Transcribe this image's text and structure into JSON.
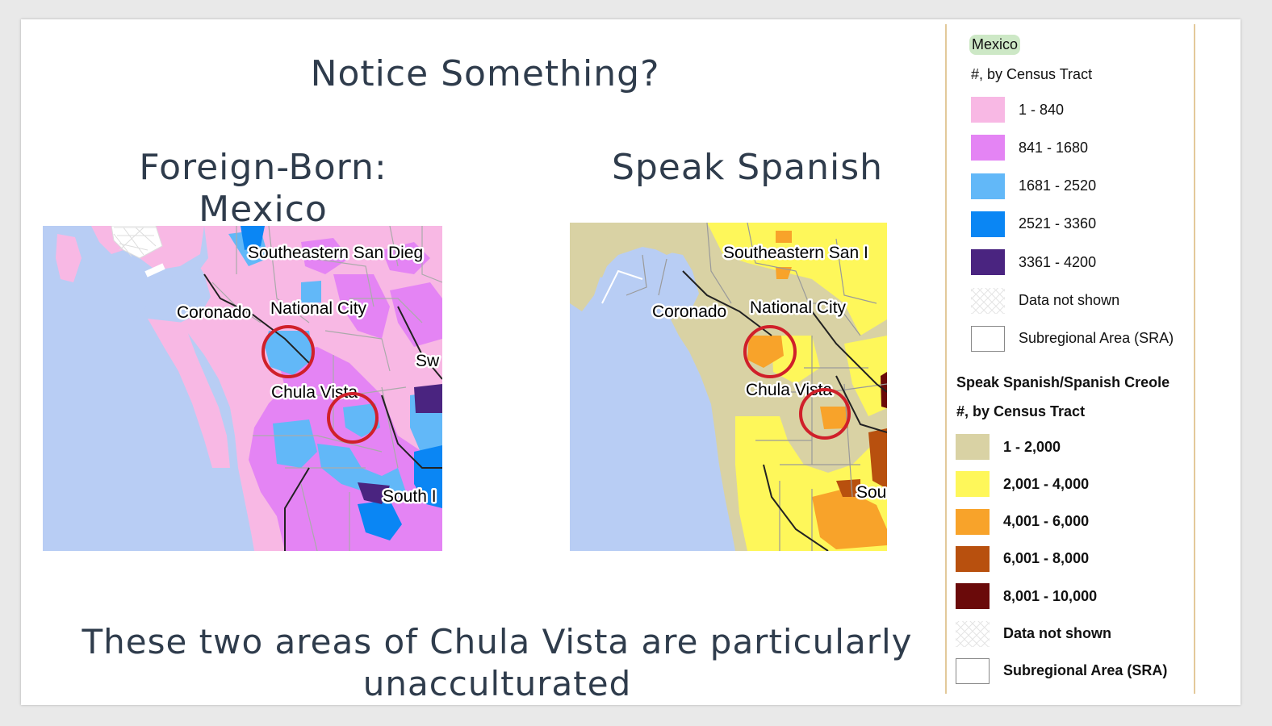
{
  "slide": {
    "title": "Notice Something?",
    "left_map_title": "Foreign-Born:\nMexico",
    "right_map_title": "Speak Spanish",
    "caption": "These two areas of Chula Vista are particularly unacculturated"
  },
  "maps": {
    "left": {
      "labels": {
        "southeastern": "Southeastern San Dieg",
        "coronado": "Coronado",
        "national_city": "National City",
        "chula_vista": "Chula Vista",
        "sw": "Sw",
        "south": "South I"
      }
    },
    "right": {
      "labels": {
        "southeastern": "Southeastern San I",
        "coronado": "Coronado",
        "national_city": "National City",
        "chula_vista": "Chula Vista",
        "south": "Sou"
      }
    },
    "colors": {
      "water": "#b8cdf4",
      "highlight_circle": "#d0202a"
    }
  },
  "legend": {
    "mexico": {
      "heading": "Mexico",
      "subheading": "#, by Census Tract",
      "items": [
        {
          "label": "1 - 840",
          "color": "#f8b8e4"
        },
        {
          "label": "841 - 1680",
          "color": "#e484f4"
        },
        {
          "label": "1681 - 2520",
          "color": "#62b8f8"
        },
        {
          "label": "2521 - 3360",
          "color": "#0a86f4"
        },
        {
          "label": "3361 - 4200",
          "color": "#4a2480"
        },
        {
          "label": "Data not shown",
          "color": "hatch"
        },
        {
          "label": "Subregional Area (SRA)",
          "color": "outline"
        }
      ]
    },
    "spanish": {
      "heading": "Speak Spanish/Spanish Creole",
      "subheading": "#, by Census Tract",
      "items": [
        {
          "label": "1 - 2,000",
          "color": "#d9d2a4"
        },
        {
          "label": "2,001 - 4,000",
          "color": "#fef75a"
        },
        {
          "label": "4,001 - 6,000",
          "color": "#f8a32a"
        },
        {
          "label": "6,001 - 8,000",
          "color": "#b8500e"
        },
        {
          "label": "8,001 - 10,000",
          "color": "#6a0a0a"
        },
        {
          "label": "Data not shown",
          "color": "hatch"
        },
        {
          "label": "Subregional Area (SRA)",
          "color": "outline"
        }
      ]
    }
  }
}
